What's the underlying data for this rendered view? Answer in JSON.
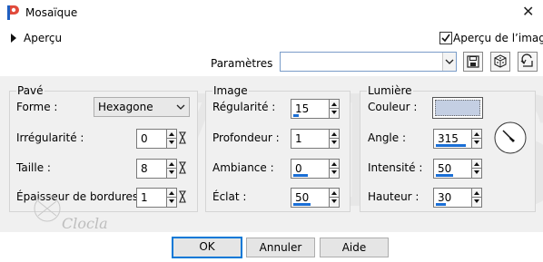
{
  "window": {
    "title": "Mosaïque",
    "close_glyph": "✕"
  },
  "preview": {
    "expander_label": "Aperçu",
    "checkbox_label": "Aperçu de l’image",
    "checkbox_checked": true
  },
  "params": {
    "label": "Paramètres",
    "value": ""
  },
  "pave": {
    "group_title": "Pavé",
    "forme_label": "Forme :",
    "forme_value": "Hexagone",
    "irregularite_label": "Irrégularité :",
    "irregularite_value": "0",
    "taille_label": "Taille :",
    "taille_value": "8",
    "epaisseur_label": "Épaisseur de bordures :",
    "epaisseur_value": "1"
  },
  "image": {
    "group_title": "Image",
    "regularite_label": "Régularité :",
    "regularite_value": "15",
    "regularite_level": 0.15,
    "profondeur_label": "Profondeur :",
    "profondeur_value": "1",
    "ambiance_label": "Ambiance :",
    "ambiance_value": "0",
    "ambiance_level": 0.0,
    "eclat_label": "Éclat :",
    "eclat_value": "50",
    "eclat_level": 0.5
  },
  "lumiere": {
    "group_title": "Lumière",
    "couleur_label": "Couleur :",
    "couleur_value": "#c4cfe3",
    "angle_label": "Angle :",
    "angle_value": "315",
    "angle_level": 0.875,
    "intensite_label": "Intensité :",
    "intensite_value": "50",
    "intensite_level": 0.5,
    "hauteur_label": "Hauteur :",
    "hauteur_value": "30",
    "hauteur_level": 0.3
  },
  "buttons": {
    "ok": "OK",
    "cancel": "Annuler",
    "help": "Aide"
  },
  "watermark": {
    "text": "VERS",
    "signature": "Clocla"
  },
  "colors": {
    "accent": "#0078d7",
    "slider": "#1a6fd6",
    "panel": "#f0f0f0"
  }
}
